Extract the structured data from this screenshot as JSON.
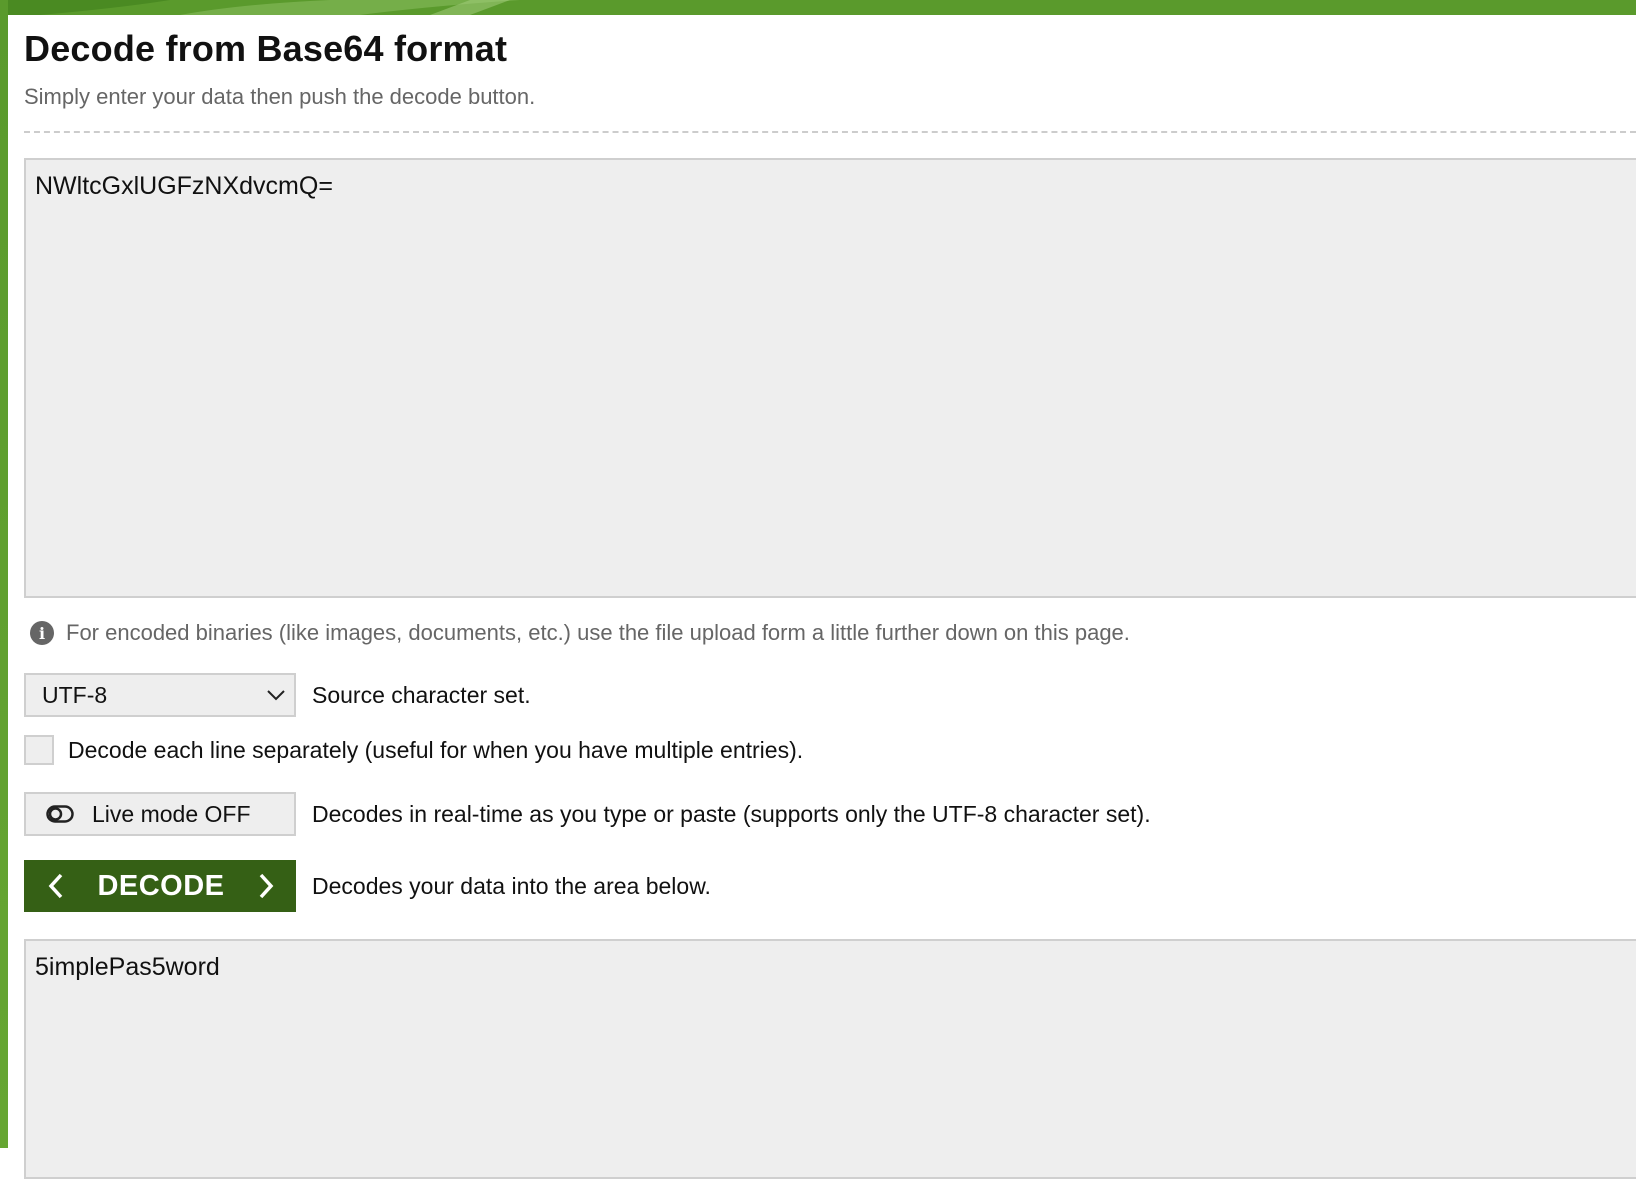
{
  "page": {
    "title": "Decode from Base64 format",
    "subtitle": "Simply enter your data then push the decode button."
  },
  "input": {
    "value": "NWltcGxlUGFzNXdvcmQ="
  },
  "info": {
    "text": "For encoded binaries (like images, documents, etc.) use the file upload form a little further down on this page."
  },
  "charset": {
    "selected": "UTF-8",
    "description": "Source character set."
  },
  "line_option": {
    "checked": false,
    "label": "Decode each line separately (useful for when you have multiple entries)."
  },
  "live_mode": {
    "label": "Live mode OFF",
    "description": "Decodes in real-time as you type or paste (supports only the UTF-8 character set)."
  },
  "decode": {
    "label": "DECODE",
    "description": "Decodes your data into the area below."
  },
  "output": {
    "value": "5implePas5word"
  },
  "colors": {
    "brand_green": "#5a9a2c",
    "button_green": "#356015",
    "field_bg": "#eeeeee"
  },
  "icons": [
    "info-icon",
    "chevron-down-icon",
    "toggle-off-icon",
    "chevron-left-icon",
    "chevron-right-icon"
  ]
}
